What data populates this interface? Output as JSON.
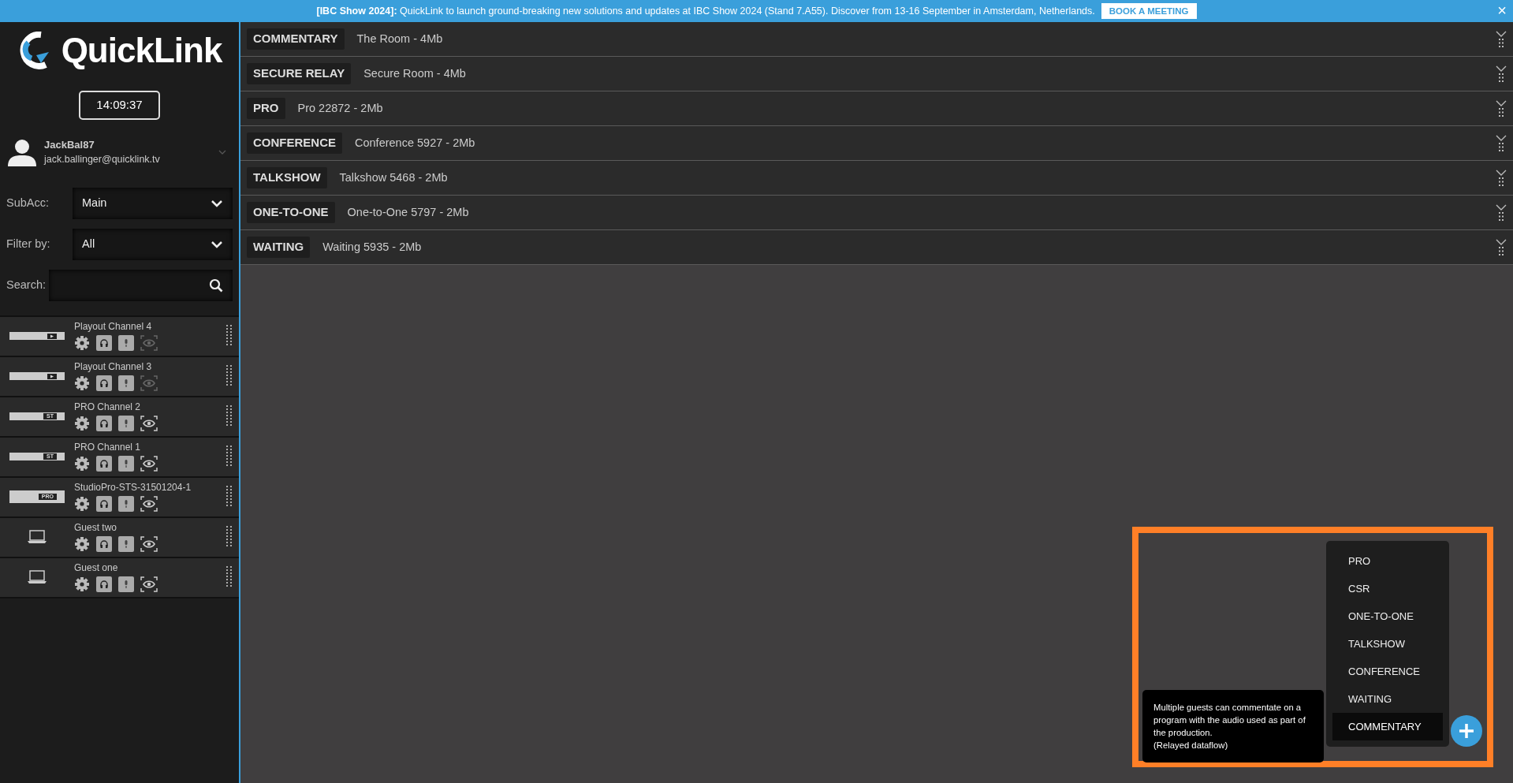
{
  "banner": {
    "text": "**[IBC Show 2024]:** QuickLink to launch ground-breaking new solutions and updates at IBC Show 2024 (Stand 7.A55). Discover from 13-16 September in Amsterdam, Netherlands.",
    "button": "BOOK A MEETING",
    "close": "×"
  },
  "logo": {
    "text": "QuickLink"
  },
  "clock": "14:09:37",
  "user": {
    "name": "JackBal87",
    "email": "jack.ballinger@quicklink.tv"
  },
  "filters": [
    {
      "kind": "select",
      "label": "SubAcc:",
      "value": "Main"
    },
    {
      "kind": "select",
      "label": "Filter by:",
      "value": "All"
    },
    {
      "kind": "search",
      "label": "Search:"
    }
  ],
  "devices": [
    {
      "kind": "playout",
      "name": "Playout Channel 4",
      "preview_enabled": false
    },
    {
      "kind": "playout",
      "name": "Playout Channel 3",
      "preview_enabled": false
    },
    {
      "kind": "st",
      "badge": "ST",
      "name": "PRO Channel 2",
      "preview_enabled": true
    },
    {
      "kind": "st",
      "badge": "ST",
      "name": "PRO Channel 1",
      "preview_enabled": true
    },
    {
      "kind": "pro",
      "badge": "PRO",
      "name": "StudioPro-STS-31501204-1",
      "preview_enabled": true
    },
    {
      "kind": "laptop",
      "name": "Guest two",
      "preview_enabled": true
    },
    {
      "kind": "laptop",
      "name": "Guest one",
      "preview_enabled": true
    }
  ],
  "rooms": [
    {
      "type": "COMMENTARY",
      "name": "The Room - 4Mb"
    },
    {
      "type": "SECURE RELAY",
      "name": "Secure Room - 4Mb"
    },
    {
      "type": "PRO",
      "name": "Pro 22872 - 2Mb"
    },
    {
      "type": "CONFERENCE",
      "name": "Conference 5927 - 2Mb"
    },
    {
      "type": "TALKSHOW",
      "name": "Talkshow 5468 - 2Mb"
    },
    {
      "type": "ONE-TO-ONE",
      "name": "One-to-One 5797 - 2Mb"
    },
    {
      "type": "WAITING",
      "name": "Waiting 5935 - 2Mb"
    }
  ],
  "add_menu": {
    "items": [
      {
        "label": "PRO",
        "selected": false
      },
      {
        "label": "CSR",
        "selected": false
      },
      {
        "label": "ONE-TO-ONE",
        "selected": false
      },
      {
        "label": "TALKSHOW",
        "selected": false
      },
      {
        "label": "CONFERENCE",
        "selected": false
      },
      {
        "label": "WAITING",
        "selected": false
      },
      {
        "label": "COMMENTARY",
        "selected": true
      }
    ],
    "tooltip": {
      "text": "Multiple guests can commentate on a program with the audio used as part of the production.",
      "note": "(Relayed dataflow)"
    }
  }
}
